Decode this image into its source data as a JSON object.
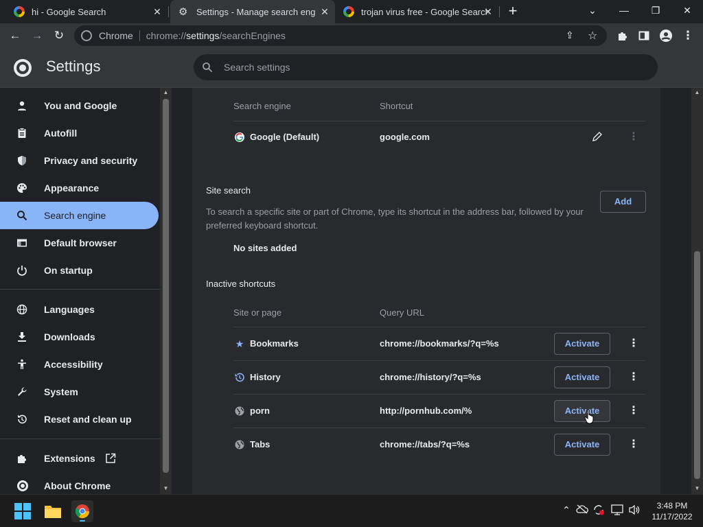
{
  "tabs": [
    {
      "title": "hi - Google Search",
      "icon": "google-icon",
      "close": "✕"
    },
    {
      "title": "Settings - Manage search engine",
      "icon": "gear-icon",
      "close": "✕"
    },
    {
      "title": "trojan virus free - Google Search",
      "icon": "google-icon",
      "close": "✕"
    }
  ],
  "window": {
    "new_tab": "+",
    "dropdown": "⌄",
    "minimize": "—",
    "restore": "❐",
    "close": "✕"
  },
  "omnibox": {
    "site_label": "Chrome",
    "url_scheme": "chrome://",
    "url_host": "settings",
    "url_path": "/searchEngines"
  },
  "header": {
    "title": "Settings",
    "search_placeholder": "Search settings"
  },
  "sidebar": {
    "items": [
      {
        "label": "You and Google",
        "icon": "person-icon"
      },
      {
        "label": "Autofill",
        "icon": "clipboard-icon"
      },
      {
        "label": "Privacy and security",
        "icon": "shield-icon"
      },
      {
        "label": "Appearance",
        "icon": "palette-icon"
      },
      {
        "label": "Search engine",
        "icon": "search-icon",
        "selected": true
      },
      {
        "label": "Default browser",
        "icon": "browser-icon"
      },
      {
        "label": "On startup",
        "icon": "power-icon"
      },
      {
        "label": "Languages",
        "icon": "globe-icon"
      },
      {
        "label": "Downloads",
        "icon": "download-icon"
      },
      {
        "label": "Accessibility",
        "icon": "accessibility-icon"
      },
      {
        "label": "System",
        "icon": "wrench-icon"
      },
      {
        "label": "Reset and clean up",
        "icon": "reset-icon"
      },
      {
        "label": "Extensions",
        "icon": "puzzle-icon"
      },
      {
        "label": "About Chrome",
        "icon": "chrome-icon"
      }
    ]
  },
  "search_engines": {
    "col_engine": "Search engine",
    "col_shortcut": "Shortcut",
    "rows": [
      {
        "name": "Google (Default)",
        "shortcut": "google.com"
      }
    ]
  },
  "site_search": {
    "title": "Site search",
    "description": "To search a specific site or part of Chrome, type its shortcut in the address bar, followed by your preferred keyboard shortcut.",
    "add_label": "Add",
    "empty_text": "No sites added"
  },
  "inactive": {
    "title": "Inactive shortcuts",
    "col_site": "Site or page",
    "col_url": "Query URL",
    "activate_label": "Activate",
    "rows": [
      {
        "name": "Bookmarks",
        "url": "chrome://bookmarks/?q=%s",
        "icon": "star-icon"
      },
      {
        "name": "History",
        "url": "chrome://history/?q=%s",
        "icon": "history-icon"
      },
      {
        "name": "porn",
        "url": "http://pornhub.com/%",
        "icon": "globe-icon"
      },
      {
        "name": "Tabs",
        "url": "chrome://tabs/?q=%s",
        "icon": "globe-icon"
      }
    ]
  },
  "taskbar": {
    "time": "3:48 PM",
    "date": "11/17/2022"
  },
  "colors": {
    "accent": "#8ab4f8",
    "background": "#202124",
    "card": "#292a2d",
    "header": "#35363a"
  }
}
